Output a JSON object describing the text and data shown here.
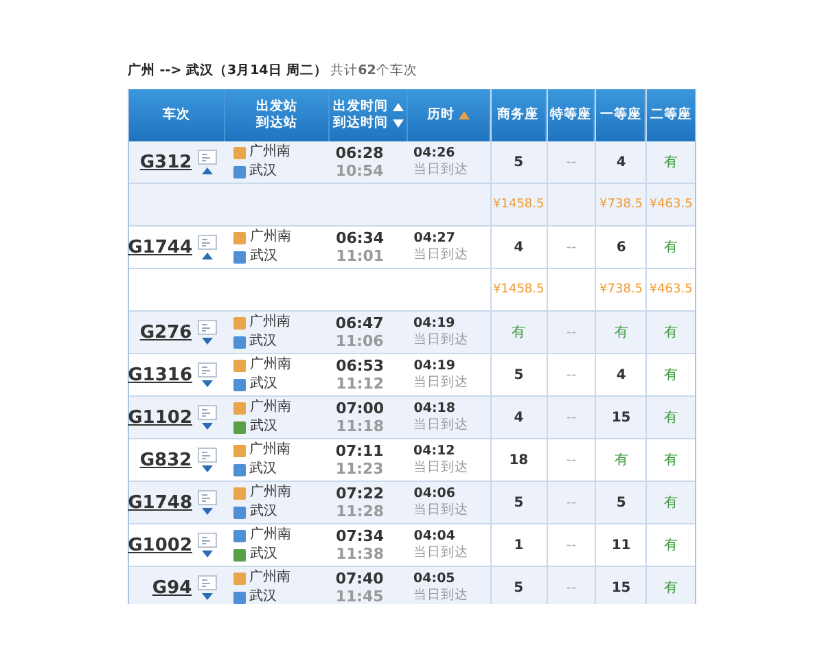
{
  "query": {
    "route": "广州 --> 武汉（3月14日  周二）",
    "count": "共计**62**个车次"
  },
  "columns": [
    {
      "kind": "single",
      "lines": [
        "车次"
      ],
      "sorted": false
    },
    {
      "kind": "double",
      "lines": [
        "出发站",
        "到达站"
      ],
      "sorted": false
    },
    {
      "kind": "double-sort",
      "lines": [
        "出发时间",
        "到达时间"
      ],
      "sorted": false
    },
    {
      "kind": "single",
      "lines": [
        "历时"
      ],
      "sorted": true
    },
    {
      "kind": "single",
      "lines": [
        "商务座"
      ],
      "sorted": false
    },
    {
      "kind": "single",
      "lines": [
        "特等座"
      ],
      "sorted": false
    },
    {
      "kind": "single",
      "lines": [
        "一等座"
      ],
      "sorted": false
    },
    {
      "kind": "single",
      "lines": [
        "二等座"
      ],
      "sorted": false
    }
  ],
  "trains": [
    {
      "number": "G312",
      "expanded": true,
      "from": {
        "name": "广州南",
        "kind": "start"
      },
      "to": {
        "name": "武汉",
        "kind": "pass"
      },
      "depart": "06:28",
      "arrive": "10:54",
      "duration": "04:26",
      "arrival_day": "当日到达",
      "seats": [
        {
          "text": "5",
          "kind": "count"
        },
        {
          "text": "--",
          "kind": "none"
        },
        {
          "text": "4",
          "kind": "count"
        },
        {
          "text": "有",
          "kind": "avail"
        }
      ],
      "prices": {
        "business": "¥1458.5",
        "first": "¥738.5",
        "second": "¥463.5"
      }
    },
    {
      "number": "G1744",
      "expanded": true,
      "from": {
        "name": "广州南",
        "kind": "start"
      },
      "to": {
        "name": "武汉",
        "kind": "pass"
      },
      "depart": "06:34",
      "arrive": "11:01",
      "duration": "04:27",
      "arrival_day": "当日到达",
      "seats": [
        {
          "text": "4",
          "kind": "count"
        },
        {
          "text": "--",
          "kind": "none"
        },
        {
          "text": "6",
          "kind": "count"
        },
        {
          "text": "有",
          "kind": "avail"
        }
      ],
      "prices": {
        "business": "¥1458.5",
        "first": "¥738.5",
        "second": "¥463.5"
      }
    },
    {
      "number": "G276",
      "expanded": false,
      "from": {
        "name": "广州南",
        "kind": "start"
      },
      "to": {
        "name": "武汉",
        "kind": "pass"
      },
      "depart": "06:47",
      "arrive": "11:06",
      "duration": "04:19",
      "arrival_day": "当日到达",
      "seats": [
        {
          "text": "有",
          "kind": "avail"
        },
        {
          "text": "--",
          "kind": "none"
        },
        {
          "text": "有",
          "kind": "avail"
        },
        {
          "text": "有",
          "kind": "avail"
        }
      ]
    },
    {
      "number": "G1316",
      "expanded": false,
      "from": {
        "name": "广州南",
        "kind": "start"
      },
      "to": {
        "name": "武汉",
        "kind": "pass"
      },
      "depart": "06:53",
      "arrive": "11:12",
      "duration": "04:19",
      "arrival_day": "当日到达",
      "seats": [
        {
          "text": "5",
          "kind": "count"
        },
        {
          "text": "--",
          "kind": "none"
        },
        {
          "text": "4",
          "kind": "count"
        },
        {
          "text": "有",
          "kind": "avail"
        }
      ]
    },
    {
      "number": "G1102",
      "expanded": false,
      "from": {
        "name": "广州南",
        "kind": "start"
      },
      "to": {
        "name": "武汉",
        "kind": "end"
      },
      "depart": "07:00",
      "arrive": "11:18",
      "duration": "04:18",
      "arrival_day": "当日到达",
      "seats": [
        {
          "text": "4",
          "kind": "count"
        },
        {
          "text": "--",
          "kind": "none"
        },
        {
          "text": "15",
          "kind": "count"
        },
        {
          "text": "有",
          "kind": "avail"
        }
      ]
    },
    {
      "number": "G832",
      "expanded": false,
      "from": {
        "name": "广州南",
        "kind": "start"
      },
      "to": {
        "name": "武汉",
        "kind": "pass"
      },
      "depart": "07:11",
      "arrive": "11:23",
      "duration": "04:12",
      "arrival_day": "当日到达",
      "seats": [
        {
          "text": "18",
          "kind": "count"
        },
        {
          "text": "--",
          "kind": "none"
        },
        {
          "text": "有",
          "kind": "avail"
        },
        {
          "text": "有",
          "kind": "avail"
        }
      ]
    },
    {
      "number": "G1748",
      "expanded": false,
      "from": {
        "name": "广州南",
        "kind": "start"
      },
      "to": {
        "name": "武汉",
        "kind": "pass"
      },
      "depart": "07:22",
      "arrive": "11:28",
      "duration": "04:06",
      "arrival_day": "当日到达",
      "seats": [
        {
          "text": "5",
          "kind": "count"
        },
        {
          "text": "--",
          "kind": "none"
        },
        {
          "text": "5",
          "kind": "count"
        },
        {
          "text": "有",
          "kind": "avail"
        }
      ]
    },
    {
      "number": "G1002",
      "expanded": false,
      "from": {
        "name": "广州南",
        "kind": "pass"
      },
      "to": {
        "name": "武汉",
        "kind": "end"
      },
      "depart": "07:34",
      "arrive": "11:38",
      "duration": "04:04",
      "arrival_day": "当日到达",
      "seats": [
        {
          "text": "1",
          "kind": "count"
        },
        {
          "text": "--",
          "kind": "none"
        },
        {
          "text": "11",
          "kind": "count"
        },
        {
          "text": "有",
          "kind": "avail"
        }
      ]
    },
    {
      "number": "G94",
      "expanded": false,
      "from": {
        "name": "广州南",
        "kind": "start"
      },
      "to": {
        "name": "武汉",
        "kind": "pass"
      },
      "depart": "07:40",
      "arrive": "11:45",
      "duration": "04:05",
      "arrival_day": "当日到达",
      "seats": [
        {
          "text": "5",
          "kind": "count"
        },
        {
          "text": "--",
          "kind": "none"
        },
        {
          "text": "15",
          "kind": "count"
        },
        {
          "text": "有",
          "kind": "avail"
        }
      ]
    }
  ]
}
